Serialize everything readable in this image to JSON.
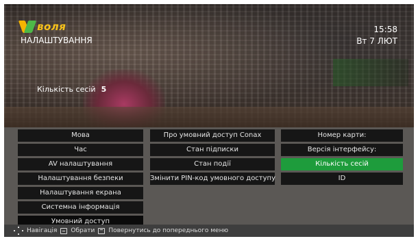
{
  "brand": {
    "logo_text": "воля"
  },
  "header": {
    "title": "НАЛАШТУВАННЯ",
    "time": "15:58",
    "date": "Вт 7 ЛЮТ"
  },
  "info": {
    "sessions_label": "Кількість сесій",
    "sessions_value": "5"
  },
  "menu": {
    "main": [
      {
        "label": "Мова"
      },
      {
        "label": "Час"
      },
      {
        "label": "AV налаштування"
      },
      {
        "label": "Налаштування безпеки"
      },
      {
        "label": "Налаштування екрана"
      },
      {
        "label": "Системна інформація"
      },
      {
        "label": "Умовний доступ"
      }
    ],
    "submenu": [
      {
        "label": "Про умовний доступ Conax"
      },
      {
        "label": "Стан підписки"
      },
      {
        "label": "Стан події"
      },
      {
        "label": "Змінити PIN-код умовного доступу"
      }
    ],
    "details": [
      {
        "label": "Номер карти:"
      },
      {
        "label": "Версія інтерфейсу:"
      },
      {
        "label": "Кількість сесій"
      },
      {
        "label": "ID"
      }
    ]
  },
  "footer": {
    "navigation_label": "Навігація",
    "select_label": "Обрати",
    "back_label": "Повернутись до попереднього меню"
  },
  "colors": {
    "selected": "#1e9c3c",
    "item_bg": "#161616",
    "panel_bg": "#5b5855"
  }
}
